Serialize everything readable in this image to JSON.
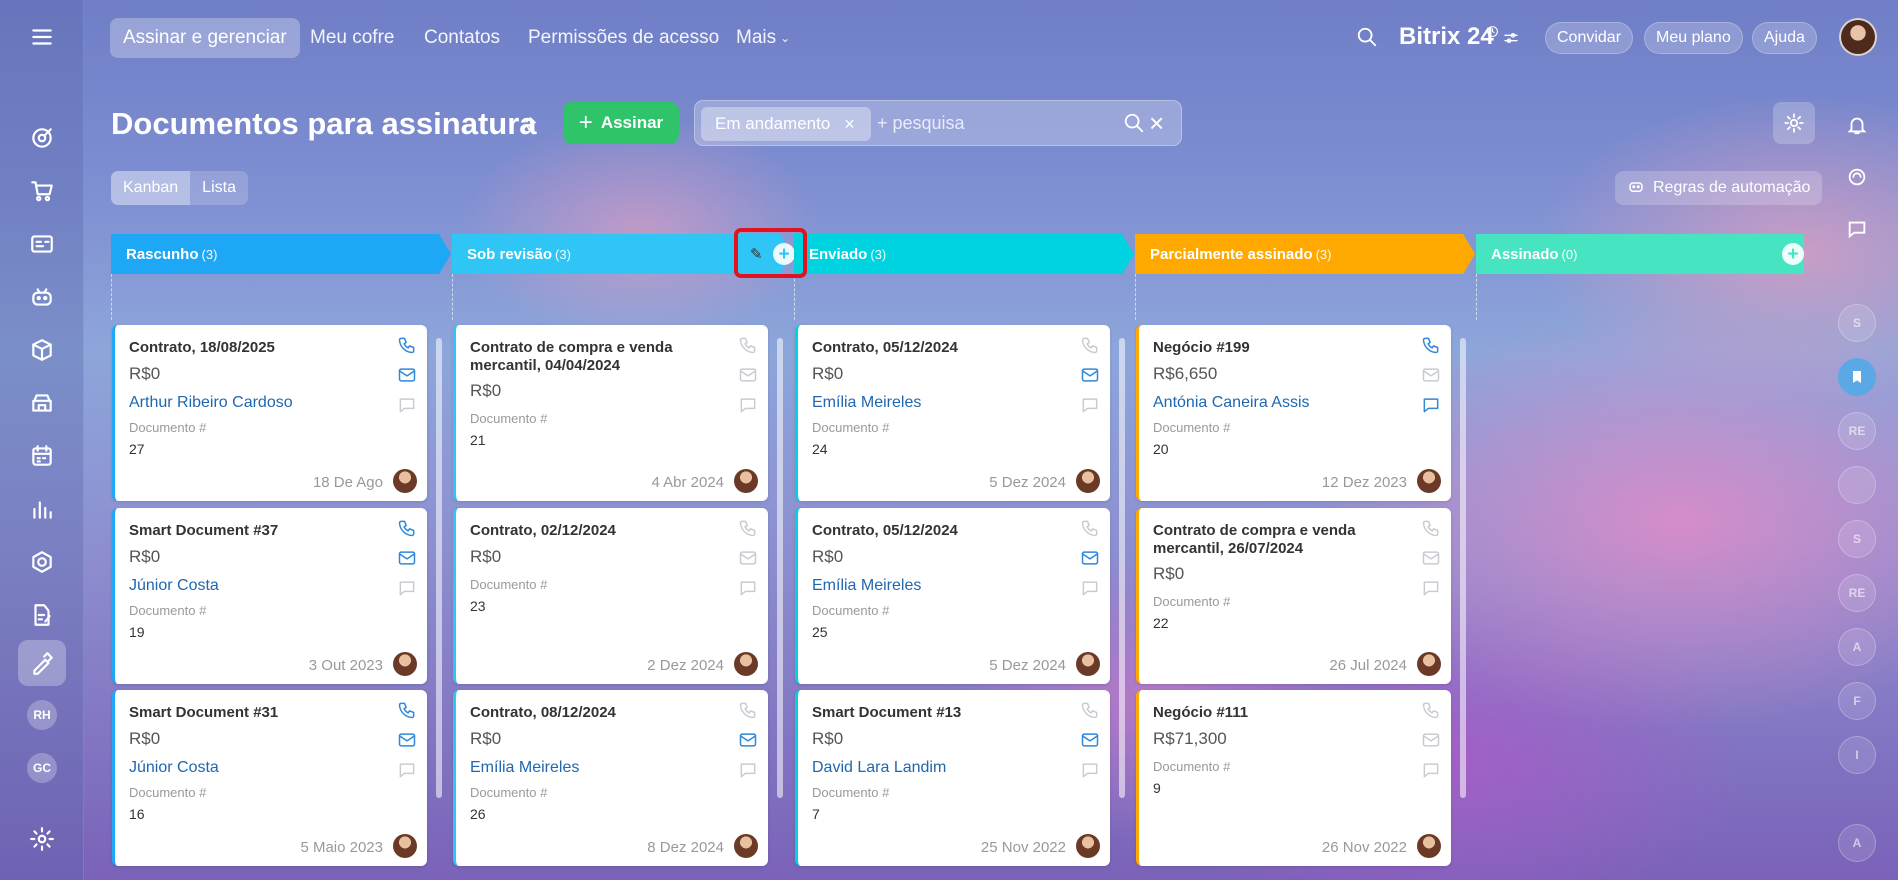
{
  "nav": {
    "items": [
      "Assinar e gerenciar",
      "Meu cofre",
      "Contatos",
      "Permissões de acesso",
      "Mais"
    ],
    "brand": "Bitrix 24",
    "invite": "Convidar",
    "my_plan": "Meu plano",
    "help": "Ajuda"
  },
  "sidebar": {
    "icons": [
      "menu-icon",
      "target-icon",
      "cart-icon",
      "contact-card-icon",
      "robot-icon",
      "box-icon",
      "store-icon",
      "calendar-icon",
      "analytics-icon",
      "hexagon-icon",
      "document-edit-icon",
      "signature-icon"
    ],
    "badges": [
      "RH",
      "GC"
    ]
  },
  "header": {
    "title": "Documentos para assinatura",
    "sign_button": "Assinar",
    "filter_chip": "Em andamento",
    "search_placeholder": "+ pesquisa",
    "views": [
      "Kanban",
      "Lista"
    ],
    "automation_rules": "Regras de automação"
  },
  "right_rail": {
    "badges": [
      "S",
      "RE",
      "S",
      "RE",
      "A",
      "F",
      "I",
      "A"
    ]
  },
  "columns": [
    {
      "name": "Rascunho",
      "count": "(3)",
      "color": "#1ea7f4",
      "cards": [
        {
          "title": "Contrato, 18/08/2025",
          "amount": "R$0",
          "contact": "Arthur Ribeiro Cardoso",
          "doc_label": "Documento #",
          "doc_num": "27",
          "date": "18 De Ago",
          "phone": true,
          "mail": true,
          "chat": false
        },
        {
          "title": "Smart Document #37",
          "amount": "R$0",
          "contact": "Júnior Costa",
          "doc_label": "Documento #",
          "doc_num": "19",
          "date": "3 Out 2023",
          "phone": true,
          "mail": true,
          "chat": false
        },
        {
          "title": "Smart Document #31",
          "amount": "R$0",
          "contact": "Júnior Costa",
          "doc_label": "Documento #",
          "doc_num": "16",
          "date": "5 Maio 2023",
          "phone": true,
          "mail": true,
          "chat": false
        }
      ]
    },
    {
      "name": "Sob revisão",
      "count": "(3)",
      "color": "#2fc6f6",
      "cards": [
        {
          "title": "Contrato de compra e venda mercantil, 04/04/2024",
          "amount": "R$0",
          "contact": "",
          "doc_label": "Documento #",
          "doc_num": "21",
          "date": "4 Abr 2024",
          "phone": false,
          "mail": false,
          "chat": false
        },
        {
          "title": "Contrato, 02/12/2024",
          "amount": "R$0",
          "contact": "",
          "doc_label": "Documento #",
          "doc_num": "23",
          "date": "2 Dez 2024",
          "phone": false,
          "mail": false,
          "chat": false
        },
        {
          "title": "Contrato, 08/12/2024",
          "amount": "R$0",
          "contact": "Emília Meireles",
          "doc_label": "Documento #",
          "doc_num": "26",
          "date": "8 Dez 2024",
          "phone": false,
          "mail": true,
          "chat": false
        }
      ]
    },
    {
      "name": "Enviado",
      "count": "(3)",
      "color": "#00d3e0",
      "cards": [
        {
          "title": "Contrato, 05/12/2024",
          "amount": "R$0",
          "contact": "Emília Meireles",
          "doc_label": "Documento #",
          "doc_num": "24",
          "date": "5 Dez 2024",
          "phone": false,
          "mail": true,
          "chat": false
        },
        {
          "title": "Contrato, 05/12/2024",
          "amount": "R$0",
          "contact": "Emília Meireles",
          "doc_label": "Documento #",
          "doc_num": "25",
          "date": "5 Dez 2024",
          "phone": false,
          "mail": true,
          "chat": false
        },
        {
          "title": "Smart Document #13",
          "amount": "R$0",
          "contact": "David Lara Landim",
          "doc_label": "Documento #",
          "doc_num": "7",
          "date": "25 Nov 2022",
          "phone": false,
          "mail": true,
          "chat": false
        }
      ]
    },
    {
      "name": "Parcialmente assinado",
      "count": "(3)",
      "color": "#ffa900",
      "cards": [
        {
          "title": "Negócio #199",
          "amount": "R$6,650",
          "contact": "Antónia Caneira Assis",
          "doc_label": "Documento #",
          "doc_num": "20",
          "date": "12 Dez 2023",
          "phone": true,
          "mail": false,
          "chat": true
        },
        {
          "title": "Contrato de compra e venda mercantil, 26/07/2024",
          "amount": "R$0",
          "contact": "",
          "doc_label": "Documento #",
          "doc_num": "22",
          "date": "26 Jul 2024",
          "phone": false,
          "mail": false,
          "chat": false
        },
        {
          "title": "Negócio #111",
          "amount": "R$71,300",
          "contact": "",
          "doc_label": "Documento #",
          "doc_num": "9",
          "date": "26 Nov 2022",
          "phone": false,
          "mail": false,
          "chat": false
        }
      ]
    },
    {
      "name": "Assinado",
      "count": "(0)",
      "color": "#47e4c2",
      "cards": []
    }
  ]
}
